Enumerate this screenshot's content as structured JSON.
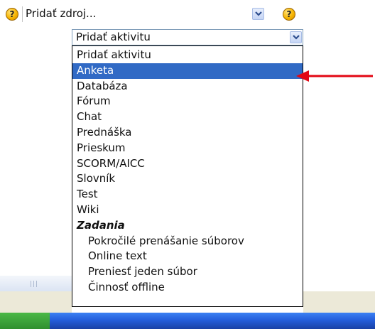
{
  "resource_select": {
    "label": "Pridať zdroj..."
  },
  "activity_select": {
    "label": "Pridať aktivitu"
  },
  "help_icon_glyph": "?",
  "activity_options": [
    {
      "label": "Pridať aktivitu",
      "type": "option"
    },
    {
      "label": "Anketa",
      "type": "option",
      "selected": true
    },
    {
      "label": "Databáza",
      "type": "option"
    },
    {
      "label": "Fórum",
      "type": "option"
    },
    {
      "label": "Chat",
      "type": "option"
    },
    {
      "label": "Prednáška",
      "type": "option"
    },
    {
      "label": "Prieskum",
      "type": "option"
    },
    {
      "label": "SCORM/AICC",
      "type": "option"
    },
    {
      "label": "Slovník",
      "type": "option"
    },
    {
      "label": "Test",
      "type": "option"
    },
    {
      "label": "Wiki",
      "type": "option"
    },
    {
      "label": "Zadania",
      "type": "group"
    },
    {
      "label": "Pokročilé prenášanie súborov",
      "type": "sub"
    },
    {
      "label": "Online text",
      "type": "sub"
    },
    {
      "label": "Preniesť jeden súbor",
      "type": "sub"
    },
    {
      "label": "Činnosť offline",
      "type": "sub"
    }
  ],
  "colors": {
    "selection": "#316ac5",
    "arrow": "#e30613",
    "help_icon": "#f7b500"
  },
  "icons": [
    "help-icon",
    "chevron-down-icon",
    "red-arrow-icon"
  ]
}
